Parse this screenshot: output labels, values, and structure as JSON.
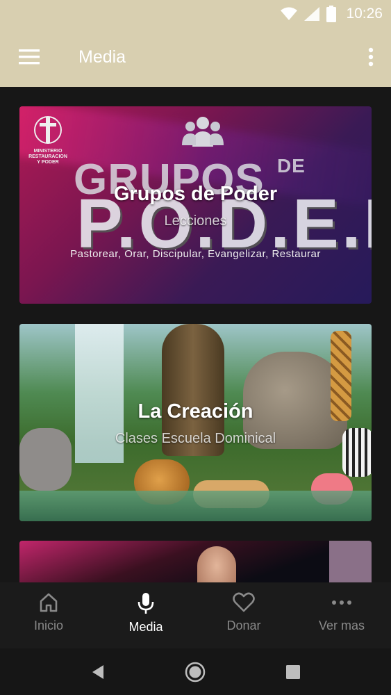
{
  "status_bar": {
    "time": "10:26",
    "icons": [
      "wifi-icon",
      "signal-icon",
      "battery-icon"
    ]
  },
  "app_bar": {
    "title": "Media",
    "background": "#d8cfb0",
    "icons": [
      "menu-icon",
      "more-vert-icon"
    ]
  },
  "cards": [
    {
      "title": "Grupos de Poder",
      "subtitle": "Lecciones",
      "artwork": {
        "word": "GRUPOS",
        "small_word": "DE",
        "big_word": "P.O.D.E.R",
        "tagline": "Pastorear, Orar, Discipular, Evangelizar, Restaurar",
        "logo_text": "MINISTERIO RESTAURACION Y PODER"
      }
    },
    {
      "title": "La Creación",
      "subtitle": "Clases Escuela Dominical"
    },
    {
      "title": "",
      "subtitle": ""
    }
  ],
  "bottom_nav": {
    "items": [
      {
        "label": "Inicio",
        "icon": "home-icon",
        "active": false
      },
      {
        "label": "Media",
        "icon": "mic-icon",
        "active": true
      },
      {
        "label": "Donar",
        "icon": "heart-icon",
        "active": false
      },
      {
        "label": "Ver mas",
        "icon": "more-horiz-icon",
        "active": false
      }
    ]
  },
  "system_nav": {
    "icons": [
      "back-icon",
      "home-circle-icon",
      "recents-icon"
    ]
  }
}
